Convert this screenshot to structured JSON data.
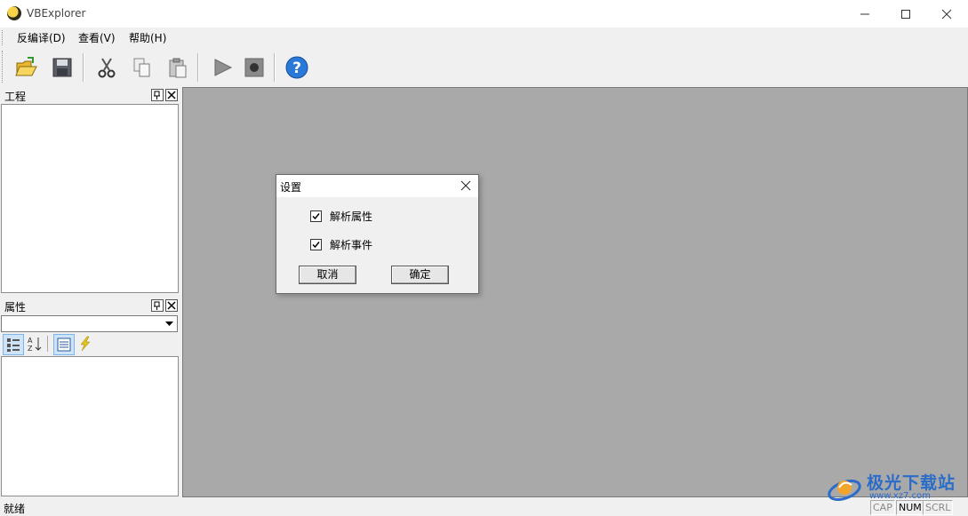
{
  "window": {
    "title": "VBExplorer"
  },
  "menu": {
    "decompile": "反编译(D)",
    "view": "查看(V)",
    "help": "帮助(H)"
  },
  "toolbar": {
    "icons": [
      "open-folder-icon",
      "save-icon",
      "cut-icon",
      "copy-icon",
      "paste-icon",
      "run-icon",
      "stop-icon",
      "help-icon"
    ]
  },
  "project_panel": {
    "title": "工程"
  },
  "properties_panel": {
    "title": "属性",
    "combo_value": ""
  },
  "dialog": {
    "title": "设置",
    "options": [
      {
        "label": "解析属性",
        "checked": true
      },
      {
        "label": "解析事件",
        "checked": true
      }
    ],
    "cancel": "取消",
    "ok": "确定"
  },
  "status": {
    "text": "就绪",
    "cap": "CAP",
    "num": "NUM",
    "scrl": "SCRL"
  },
  "watermark": {
    "name": "极光下载站",
    "url": "www.xz7.com"
  },
  "colors": {
    "mdi_bg": "#a9a9a9",
    "accent_blue": "#2a6cc8"
  }
}
